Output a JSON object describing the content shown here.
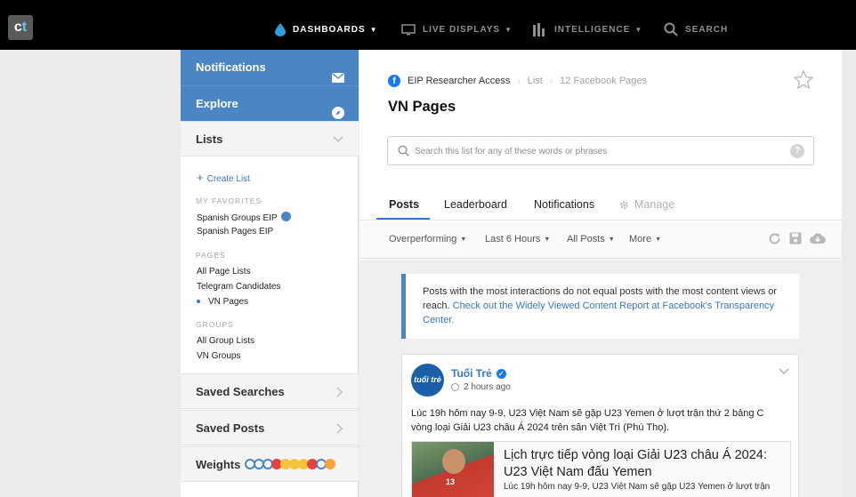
{
  "topbar": {
    "logo_main": "c",
    "logo_accent": "t",
    "nav": [
      {
        "label": "DASHBOARDS",
        "icon": "drop-icon",
        "active": true
      },
      {
        "label": "LIVE DISPLAYS",
        "icon": "monitor-icon",
        "active": false
      },
      {
        "label": "INTELLIGENCE",
        "icon": "bar-chart-icon",
        "active": false
      },
      {
        "label": "SEARCH",
        "icon": "search-icon",
        "active": false
      }
    ]
  },
  "sidebar": {
    "notifications": "Notifications",
    "explore": "Explore",
    "lists": "Lists",
    "create_list": "Create List",
    "favorites_heading": "MY FAVORITES",
    "favorites": [
      "Spanish Groups EIP",
      "Spanish Pages EIP"
    ],
    "pages_heading": "PAGES",
    "pages": [
      "All Page Lists",
      "Telegram Candidates",
      "VN Pages"
    ],
    "groups_heading": "GROUPS",
    "groups": [
      "All Group Lists",
      "VN Groups"
    ],
    "saved_searches": "Saved Searches",
    "saved_posts": "Saved Posts",
    "weights": "Weights"
  },
  "main": {
    "breadcrumb": [
      "EIP Researcher Access",
      "List",
      "12 Facebook Pages"
    ],
    "title": "VN Pages",
    "search_placeholder": "Search this list for any of these words or phrases",
    "tabs": [
      "Posts",
      "Leaderboard",
      "Notifications",
      "Manage"
    ],
    "filters": [
      "Overperforming",
      "Last 6 Hours",
      "All Posts",
      "More"
    ],
    "notice_text": "Posts with the most interactions do not equal posts with the most content views or reach. ",
    "notice_link": "Check out the Widely Viewed Content Report at Facebook's Transparency Center.",
    "post": {
      "avatar_text": "tuổi trẻ",
      "author": "Tuổi Trẻ",
      "time": "2 hours ago",
      "text": "Lúc 19h hôm nay 9-9, U23 Việt Nam sẽ gặp U23 Yemen ở lượt trận thứ 2 bảng C vòng loại Giải U23 châu Á 2024 trên sân Việt Trì (Phú Thọ).",
      "jersey_number": "13",
      "card_title": "Lịch trực tiếp vòng loại Giải U23 châu Á 2024: U23 Việt Nam đấu Yemen",
      "card_desc": "Lúc 19h hôm nay 9-9, U23 Việt Nam sẽ gặp U23 Yemen ở lượt trận"
    }
  },
  "colors": {
    "accent": "#4a86c4",
    "link": "#3a77c0",
    "topbar": "#000000"
  }
}
